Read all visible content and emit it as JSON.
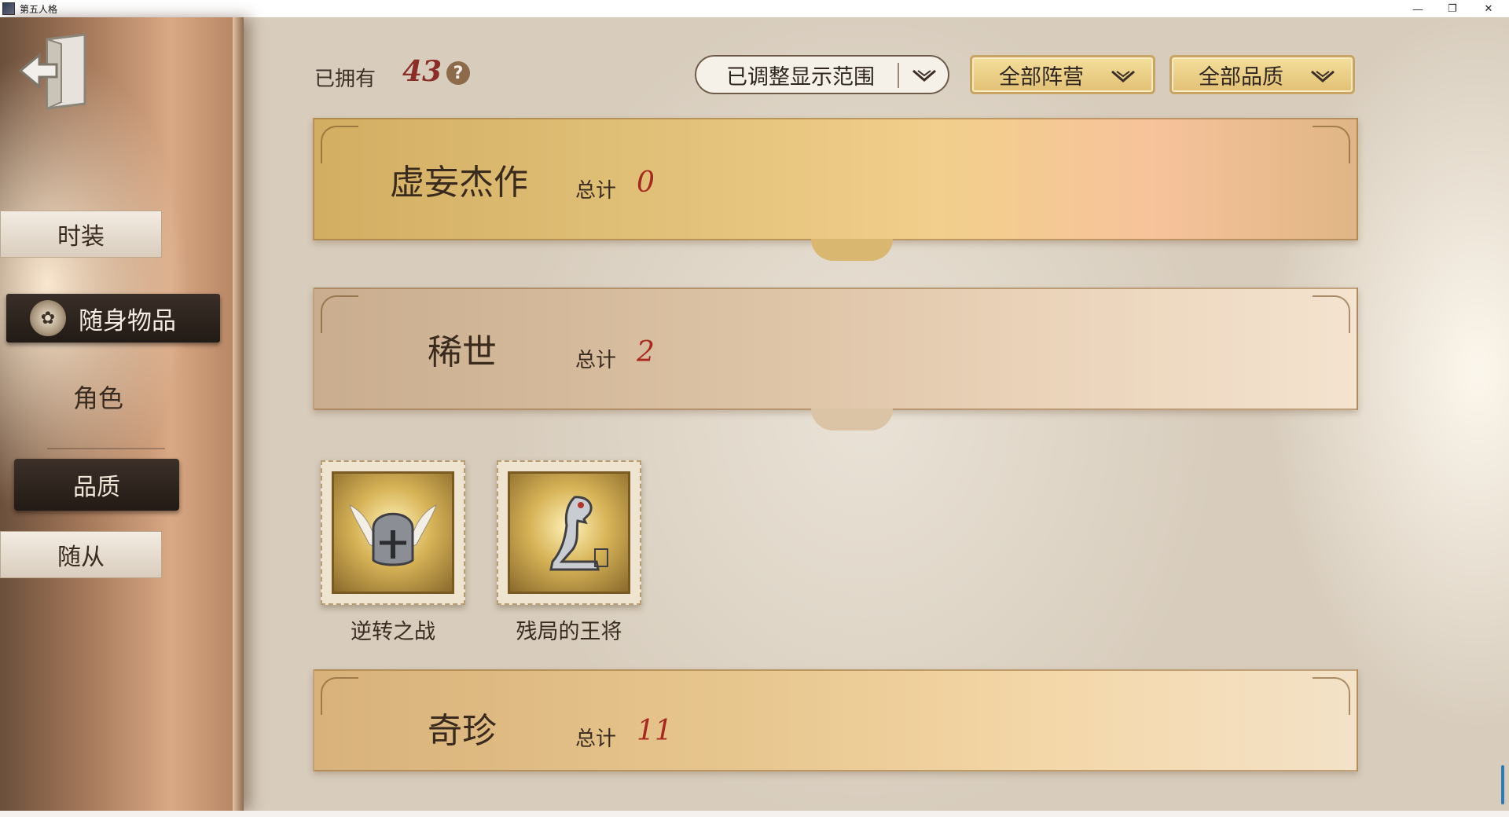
{
  "window": {
    "title": "第五人格"
  },
  "sidebar": {
    "items": [
      {
        "label": "时装"
      },
      {
        "label": "随身物品"
      },
      {
        "label": "角色"
      },
      {
        "label": "品质"
      },
      {
        "label": "随从"
      }
    ]
  },
  "header": {
    "owned_label": "已拥有",
    "owned_count": "43",
    "help": "?",
    "filter_range": "已调整显示范围",
    "filter_camp": "全部阵营",
    "filter_quality": "全部品质"
  },
  "categories": [
    {
      "title": "虚妄杰作",
      "total_label": "总计",
      "total": "0"
    },
    {
      "title": "稀世",
      "total_label": "总计",
      "total": "2"
    },
    {
      "title": "奇珍",
      "total_label": "总计",
      "total": "11"
    }
  ],
  "items": [
    {
      "name": "逆转之战",
      "icon": "winged-helmet-icon"
    },
    {
      "name": "残局的王将",
      "icon": "chess-piece-icon"
    }
  ],
  "colors": {
    "accent_red": "#a7281f",
    "gold_banner": "#e2c27a",
    "active_tab": "#2a211b"
  }
}
